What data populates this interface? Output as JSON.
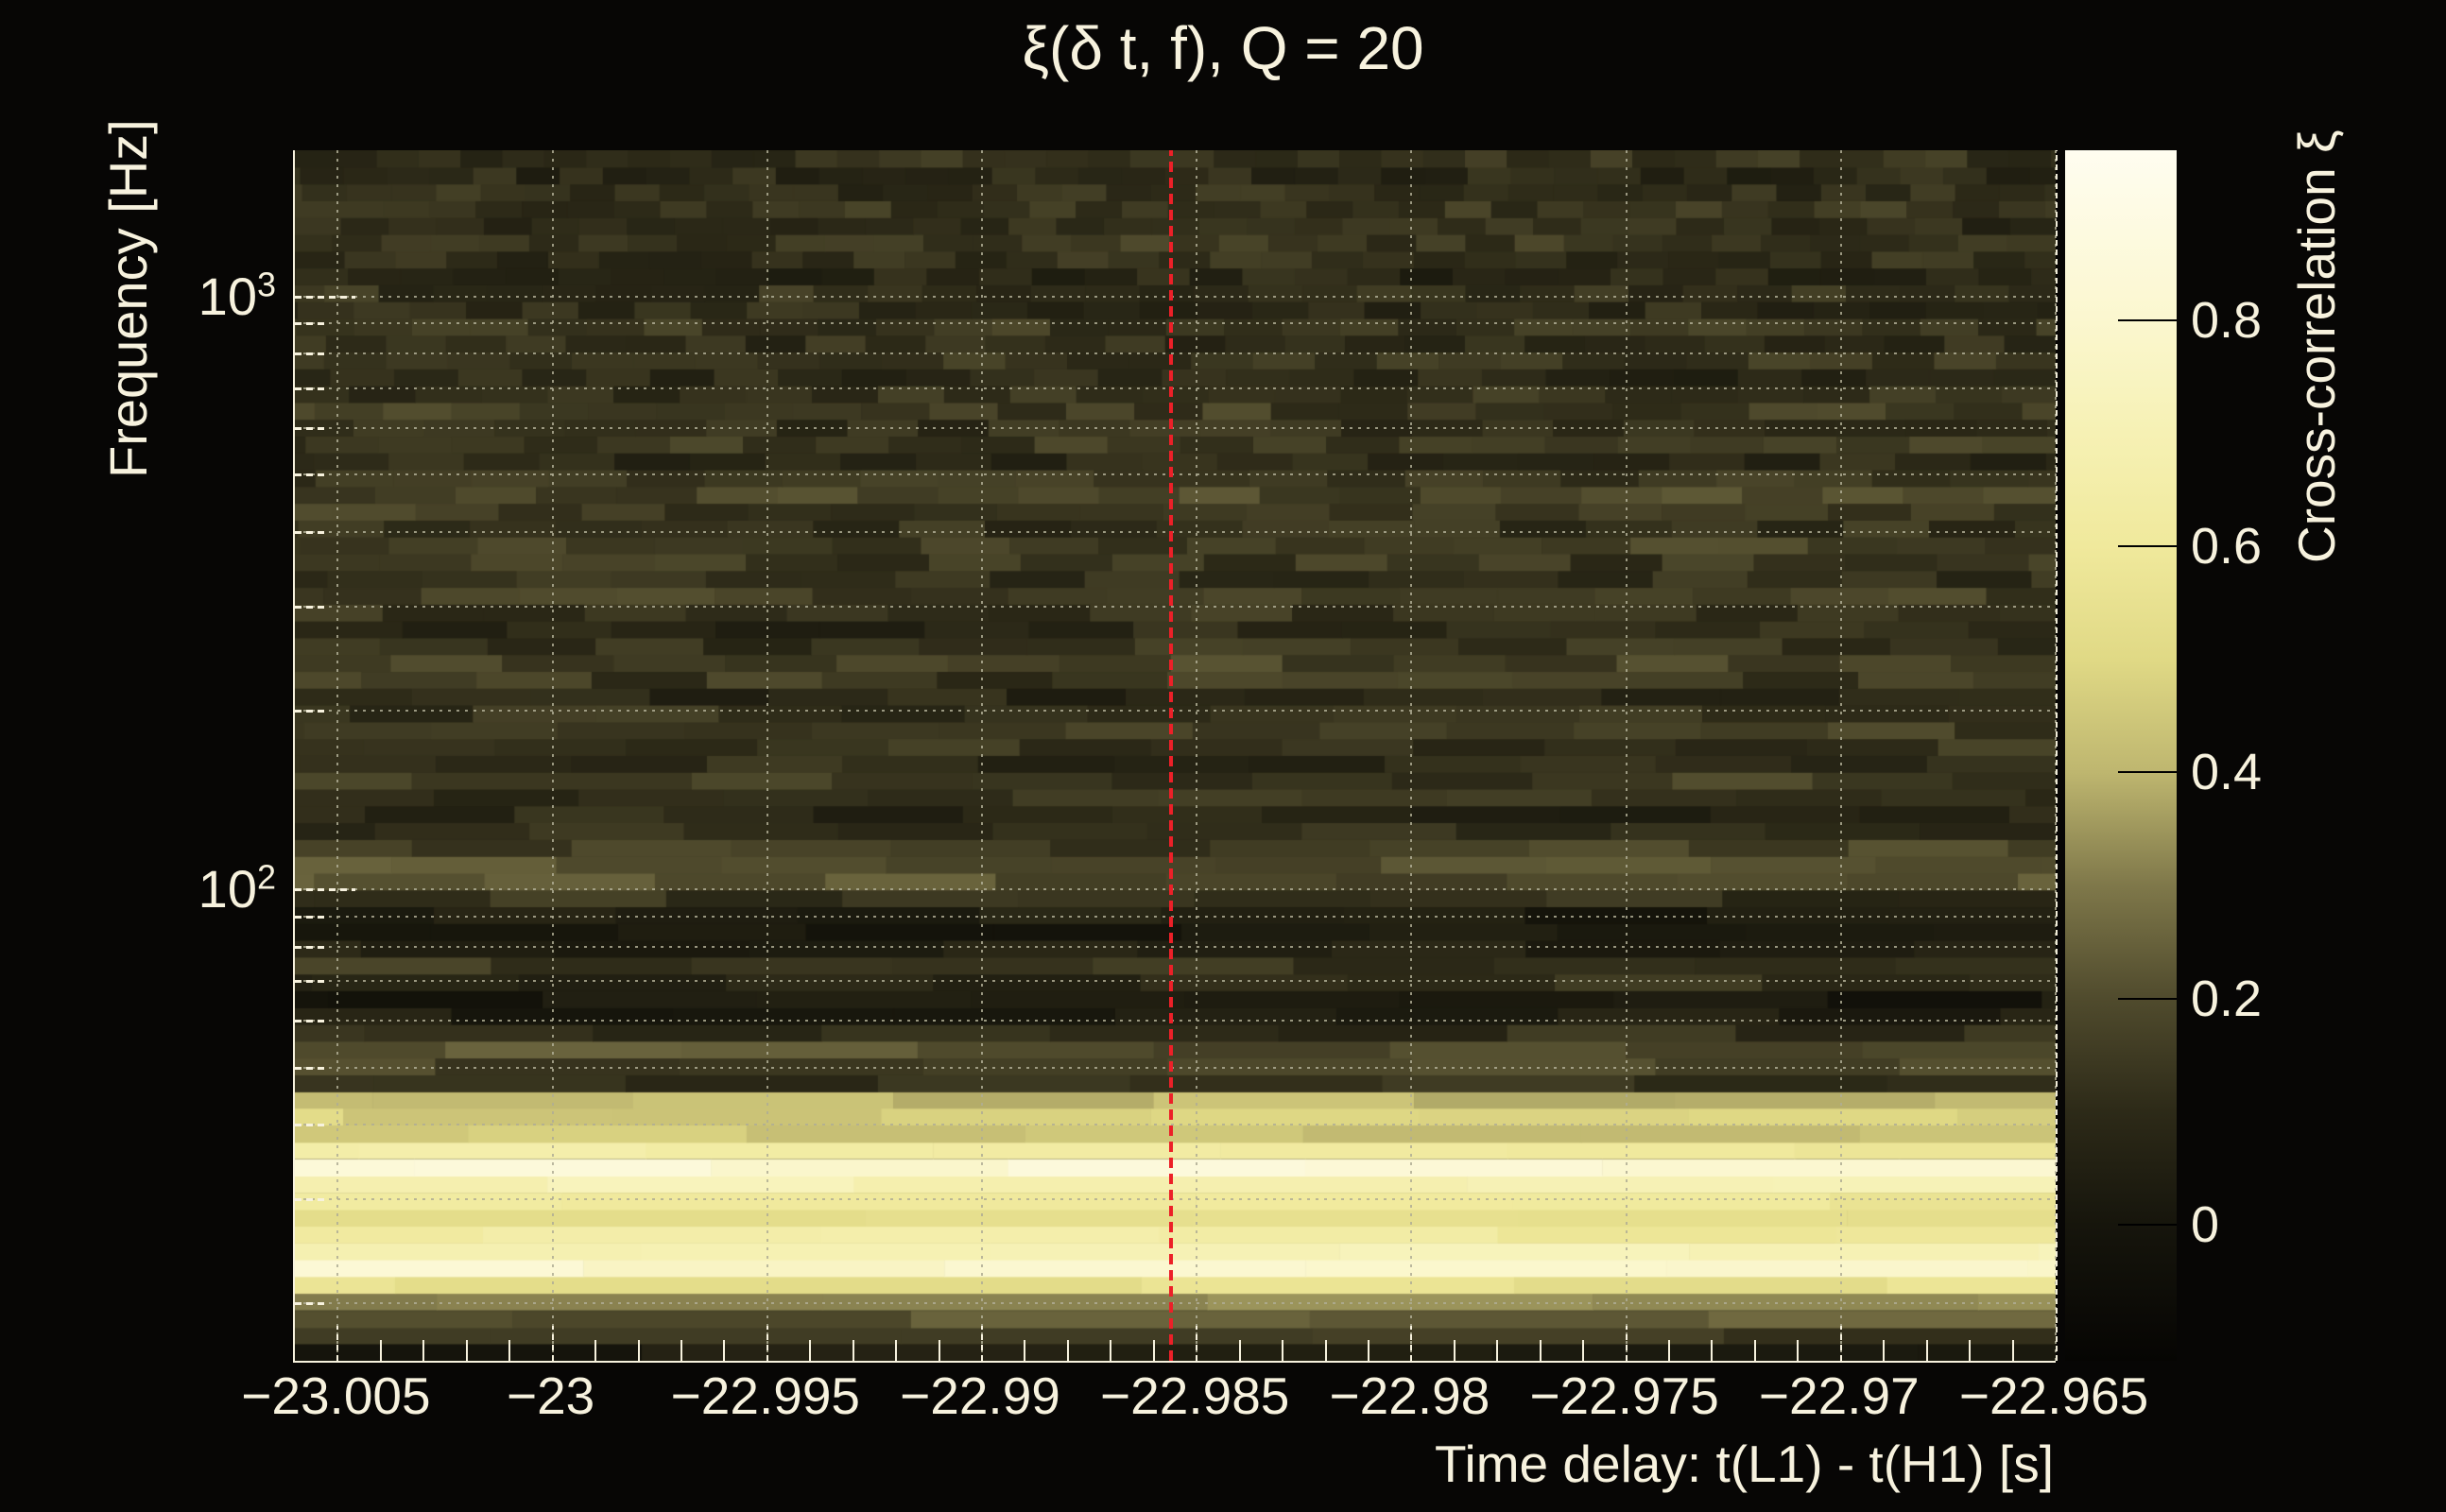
{
  "chart_data": {
    "type": "heatmap",
    "title": "ξ(δ t, f), Q = 20",
    "x_axis": {
      "label": "Time delay: t(L1) - t(H1) [s]",
      "range": [
        -23.006,
        -22.965
      ],
      "major_ticks": [
        -23.005,
        -23.0,
        -22.995,
        -22.99,
        -22.985,
        -22.98,
        -22.975,
        -22.97,
        -22.965
      ],
      "tick_labels": [
        "−23.005",
        "−23",
        "−22.995",
        "−22.99",
        "−22.985",
        "−22.98",
        "−22.975",
        "−22.97",
        "−22.965"
      ],
      "minor_tick_step": 0.001,
      "grid": true
    },
    "y_axis": {
      "label": "Frequency [Hz]",
      "scale": "log",
      "range": [
        16,
        1764
      ],
      "major_ticks": [
        100,
        1000
      ],
      "major_tick_exponents": [
        2,
        3
      ],
      "gridline_freqs": [
        20,
        30,
        40,
        50,
        60,
        70,
        80,
        90,
        100,
        200,
        300,
        400,
        500,
        600,
        700,
        800,
        900,
        1000
      ],
      "grid": true
    },
    "colorbar": {
      "label": "Cross-correlation ξ",
      "range": [
        -0.12,
        0.95
      ],
      "ticks": [
        0,
        0.2,
        0.4,
        0.6,
        0.8
      ],
      "tick_labels": [
        "0",
        "0.2",
        "0.4",
        "0.6",
        "0.8"
      ]
    },
    "marker_line": {
      "x": -22.9856,
      "color": "#ec2028",
      "style": "dashed"
    },
    "colormap_stops": [
      [
        -0.12,
        "#060503"
      ],
      [
        0.0,
        "#16150c"
      ],
      [
        0.1,
        "#2d2a18"
      ],
      [
        0.2,
        "#504b2d"
      ],
      [
        0.3,
        "#7f784a"
      ],
      [
        0.4,
        "#beb66f"
      ],
      [
        0.5,
        "#e0d985"
      ],
      [
        0.6,
        "#f0e99c"
      ],
      [
        0.7,
        "#f6f1b4"
      ],
      [
        0.8,
        "#fbf7cf"
      ],
      [
        0.95,
        "#fffdf0"
      ]
    ],
    "rows_freq_xi": [
      [
        16.0,
        0.03
      ],
      [
        17.1,
        0.15
      ],
      [
        18.2,
        0.22
      ],
      [
        19.5,
        0.35
      ],
      [
        20.8,
        0.55
      ],
      [
        22.2,
        0.8
      ],
      [
        23.7,
        0.72
      ],
      [
        25.3,
        0.62
      ],
      [
        27.0,
        0.56
      ],
      [
        28.8,
        0.6
      ],
      [
        30.8,
        0.7
      ],
      [
        32.8,
        0.82
      ],
      [
        35.1,
        0.62
      ],
      [
        37.4,
        0.44
      ],
      [
        40.0,
        0.48
      ],
      [
        42.7,
        0.42
      ],
      [
        45.5,
        0.12
      ],
      [
        48.6,
        0.17
      ],
      [
        51.9,
        0.21
      ],
      [
        55.4,
        0.12
      ],
      [
        59.1,
        0.04
      ],
      [
        63.1,
        0.02
      ],
      [
        67.4,
        0.1
      ],
      [
        71.9,
        0.14
      ],
      [
        76.8,
        0.05
      ],
      [
        82.0,
        0.0
      ],
      [
        87.5,
        0.04
      ],
      [
        93.4,
        0.12
      ],
      [
        99.7,
        0.2
      ],
      [
        106.4,
        0.22
      ],
      [
        113.6,
        0.16
      ],
      [
        121.3,
        0.11
      ],
      [
        129.5,
        0.08
      ],
      [
        138.2,
        0.12
      ],
      [
        147.5,
        0.15
      ],
      [
        157.5,
        0.1
      ],
      [
        168.1,
        0.13
      ],
      [
        179.4,
        0.16
      ],
      [
        191.5,
        0.12
      ],
      [
        204.5,
        0.08
      ],
      [
        218.3,
        0.14
      ],
      [
        233.0,
        0.18
      ],
      [
        248.7,
        0.12
      ],
      [
        265.5,
        0.09
      ],
      [
        283.4,
        0.13
      ],
      [
        302.5,
        0.16
      ],
      [
        322.9,
        0.11
      ],
      [
        344.7,
        0.14
      ],
      [
        368.0,
        0.17
      ],
      [
        392.8,
        0.12
      ],
      [
        419.3,
        0.15
      ],
      [
        447.6,
        0.18
      ],
      [
        477.8,
        0.13
      ],
      [
        510.0,
        0.1
      ],
      [
        544.5,
        0.14
      ],
      [
        581.2,
        0.11
      ],
      [
        620.4,
        0.15
      ],
      [
        662.3,
        0.12
      ],
      [
        707.0,
        0.09
      ],
      [
        754.7,
        0.13
      ],
      [
        805.6,
        0.11
      ],
      [
        860.0,
        0.14
      ],
      [
        918.0,
        0.1
      ],
      [
        980.0,
        0.12
      ],
      [
        1046.1,
        0.08
      ],
      [
        1116.7,
        0.11
      ],
      [
        1192.1,
        0.14
      ],
      [
        1272.5,
        0.1
      ],
      [
        1358.4,
        0.13
      ],
      [
        1450.1,
        0.11
      ],
      [
        1548.0,
        0.09
      ],
      [
        1652.4,
        0.12
      ]
    ],
    "tile_noise_amplitude": 0.055,
    "colors": {
      "background": "#070605",
      "text": "#f7f2de",
      "grid": "#afad94",
      "marker": "#ec2028"
    }
  }
}
